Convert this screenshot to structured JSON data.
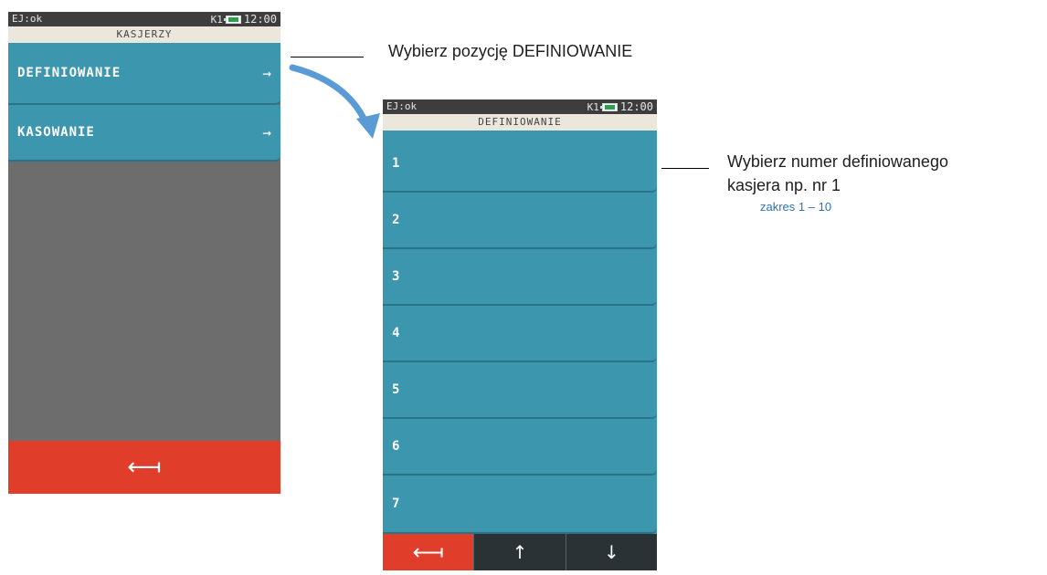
{
  "screen1": {
    "status_left": "EJ:ok",
    "status_right": "K1",
    "time": "12:00",
    "title": "KASJERZY",
    "items": [
      {
        "label": "DEFINIOWANIE",
        "arrow": "→"
      },
      {
        "label": "KASOWANIE",
        "arrow": "→"
      }
    ],
    "back_icon": "⟻"
  },
  "screen2": {
    "status_left": "EJ:ok",
    "status_right": "K1",
    "time": "12:00",
    "title": "DEFINIOWANIE",
    "items": [
      "1",
      "2",
      "3",
      "4",
      "5",
      "6",
      "7"
    ],
    "back_icon": "⟻",
    "up_icon": "↑",
    "down_icon": "↓"
  },
  "annotations": {
    "step1": "Wybierz pozycję DEFINIOWANIE",
    "step2_line1": "Wybierz numer definiowanego",
    "step2_line2": "kasjera np. nr 1",
    "range": "zakres 1 – 10"
  },
  "colors": {
    "tile": "#3c96ad",
    "back": "#e03e2a",
    "arrow_accent": "#5b9bd5"
  }
}
